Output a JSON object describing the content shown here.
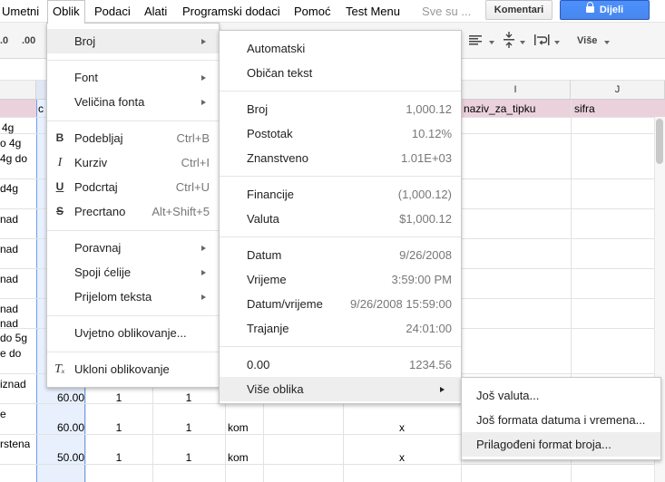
{
  "menubar": {
    "items": [
      "Umetni",
      "Oblik",
      "Podaci",
      "Alati",
      "Programski dodaci",
      "Pomoć",
      "Test Menu"
    ],
    "active": "Oblik",
    "search_label": "Sve su ...",
    "comments_label": "Komentari",
    "share_label": "Dijeli"
  },
  "toolbar": {
    "decimal_decrease": ".0",
    "decimal_increase": ".00",
    "more_label": "Više"
  },
  "grid": {
    "columns": {
      "I": "I",
      "J": "J"
    },
    "header_row": {
      "c": "c",
      "i": "naziv_za_tipku",
      "j": "sifra"
    },
    "left_cells": [
      "4g",
      "o 4g",
      "4g do",
      "d4g",
      "nad",
      "nad",
      "nad",
      "nad",
      "nad",
      "do 5g",
      "e do",
      "iznad",
      "e",
      "rstena"
    ],
    "rows": [
      {
        "c": "60.00",
        "e": "1",
        "f": "1",
        "g": "",
        "i": ""
      },
      {
        "c": "60.00",
        "e": "1",
        "f": "1",
        "g": "kom",
        "i": "x"
      },
      {
        "c": "50.00",
        "e": "1",
        "f": "1",
        "g": "kom",
        "i": "x"
      }
    ]
  },
  "menu_oblik": {
    "broj": "Broj",
    "font": "Font",
    "velicina": "Veličina fonta",
    "podebljaj": "Podebljaj",
    "podebljaj_sc": "Ctrl+B",
    "kurziv": "Kurziv",
    "kurziv_sc": "Ctrl+I",
    "podcrtaj": "Podcrtaj",
    "podcrtaj_sc": "Ctrl+U",
    "precrtano": "Precrtano",
    "precrtano_sc": "Alt+Shift+5",
    "poravnaj": "Poravnaj",
    "spoji": "Spoji ćelije",
    "prijelom": "Prijelom teksta",
    "uvjetno": "Uvjetno oblikovanje...",
    "ukloni": "Ukloni oblikovanje"
  },
  "menu_broj": {
    "automatski": "Automatski",
    "obican": "Običan tekst",
    "broj": "Broj",
    "broj_ex": "1,000.12",
    "postotak": "Postotak",
    "postotak_ex": "10.12%",
    "znanstveno": "Znanstveno",
    "znanstveno_ex": "1.01E+03",
    "financije": "Financije",
    "financije_ex": "(1,000.12)",
    "valuta": "Valuta",
    "valuta_ex": "$1,000.12",
    "datum": "Datum",
    "datum_ex": "9/26/2008",
    "vrijeme": "Vrijeme",
    "vrijeme_ex": "3:59:00 PM",
    "datumvrijeme": "Datum/vrijeme",
    "datumvrijeme_ex": "9/26/2008 15:59:00",
    "trajanje": "Trajanje",
    "trajanje_ex": "24:01:00",
    "zero": "0.00",
    "zero_ex": "1234.56",
    "vise": "Više oblika"
  },
  "menu_vise": {
    "valuta": "Još valuta...",
    "datum": "Još formata datuma i vremena...",
    "prilagodeni": "Prilagođeni format broja..."
  }
}
